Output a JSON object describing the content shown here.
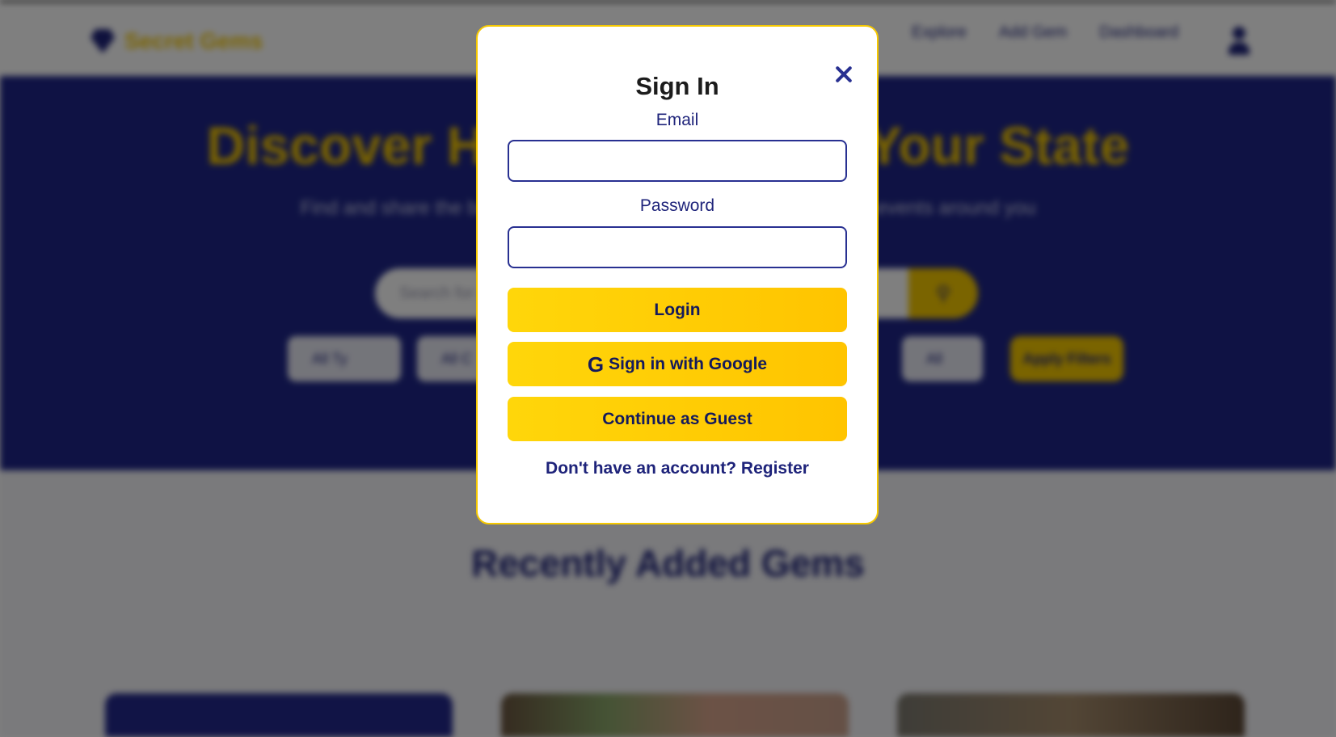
{
  "background": {
    "brand": "Secret Gems",
    "nav": [
      "Explore",
      "Add Gem",
      "Dashboard"
    ],
    "hero_title": "Discover Hidden Gems in Your State",
    "hero_subtitle": "Find and share the best local spots, hidden treasures, and exciting events around you",
    "search_placeholder": "Search for gems...",
    "filters": [
      "All Ty",
      "All C",
      "All"
    ],
    "apply_label": "Apply Filters",
    "section_title": "Recently Added Gems"
  },
  "modal": {
    "title": "Sign In",
    "email_label": "Email",
    "email_value": "",
    "password_label": "Password",
    "password_value": "",
    "login_label": "Login",
    "google_label": "Sign in with Google",
    "google_glyph": "G",
    "guest_label": "Continue as Guest",
    "register_text": "Don't have an account? Register"
  },
  "colors": {
    "accent_yellow": "#f5c800",
    "brand_navy": "#1e237a",
    "hero_blue": "#1e2588"
  }
}
